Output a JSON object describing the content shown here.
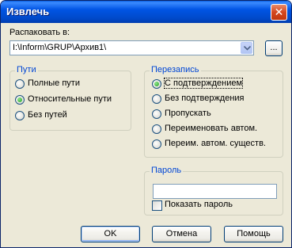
{
  "window": {
    "title": "Извлечь",
    "close_glyph": "✕"
  },
  "extract_to": {
    "label": "Распаковать в:",
    "path": "I:\\Inform\\GRUP\\Архив1\\",
    "browse_label": "..."
  },
  "paths_group": {
    "title": "Пути",
    "options": [
      {
        "label": "Полные пути",
        "selected": false
      },
      {
        "label": "Относительные пути",
        "selected": true
      },
      {
        "label": "Без путей",
        "selected": false
      }
    ]
  },
  "overwrite_group": {
    "title": "Перезапись",
    "options": [
      {
        "label": "С подтверждением",
        "selected": true
      },
      {
        "label": "Без подтверждения",
        "selected": false
      },
      {
        "label": "Пропускать",
        "selected": false
      },
      {
        "label": "Переименовать автом.",
        "selected": false
      },
      {
        "label": "Переим. автом. существ.",
        "selected": false
      }
    ]
  },
  "password_group": {
    "title": "Пароль",
    "value": "",
    "show_password_label": "Показать пароль",
    "show_password_checked": false
  },
  "buttons": {
    "ok": "OK",
    "cancel": "Отмена",
    "help": "Помощь"
  },
  "icons": {
    "close": "close-icon",
    "dropdown": "chevron-down-icon"
  }
}
